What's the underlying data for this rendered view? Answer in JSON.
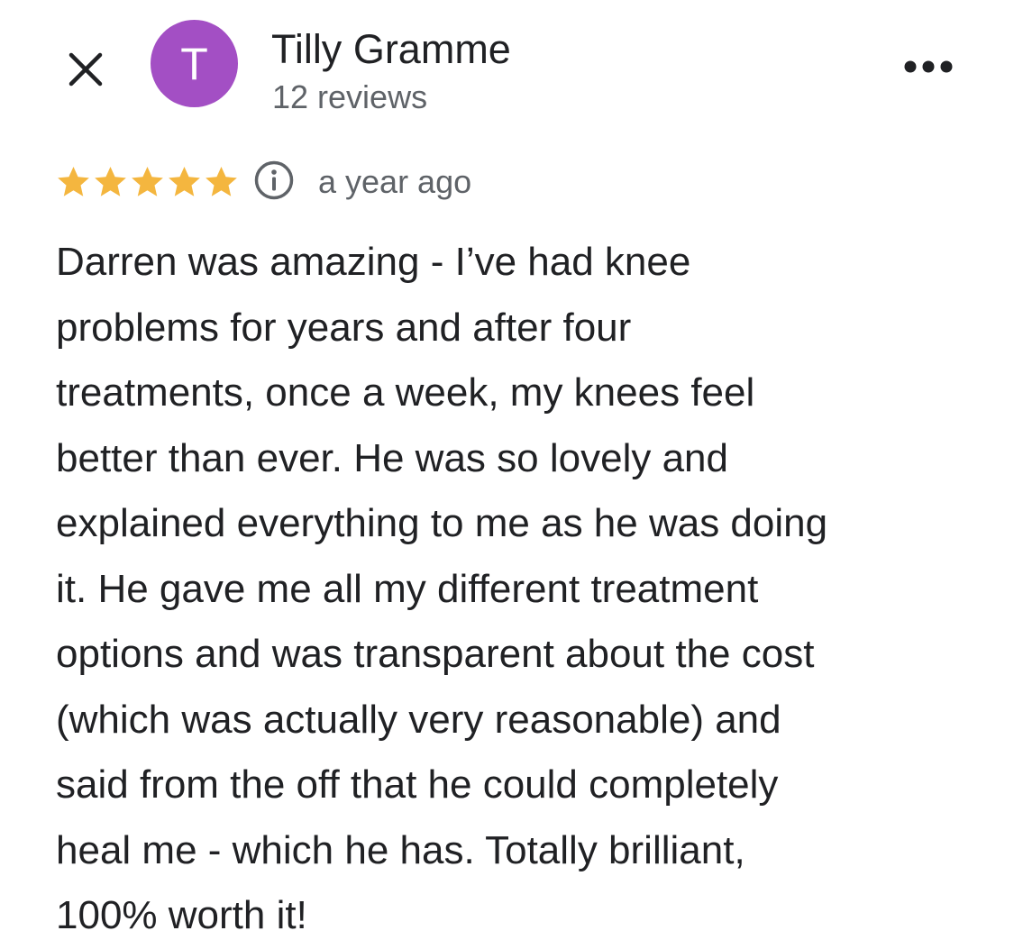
{
  "header": {
    "close_icon": "close-icon",
    "more_icon": "more-horizontal-icon"
  },
  "reviewer": {
    "avatar_letter": "T",
    "avatar_color": "#a34fc4",
    "name": "Tilly Gramme",
    "review_count": "12 reviews"
  },
  "rating": {
    "stars": 5,
    "max_stars": 5,
    "star_color": "#f4b63f",
    "info_icon": "info-icon",
    "timestamp": "a year ago"
  },
  "review": {
    "lines": [
      "Darren was amazing - I’ve had knee",
      "problems for years and after four",
      "treatments, once a week, my knees feel",
      "better than ever. He was so lovely and",
      "explained everything to me as he was doing",
      "it. He gave me all my different treatment",
      "options and was transparent about the cost",
      "(which was actually very reasonable) and",
      "said from the off that he could completely",
      "heal me - which he has. Totally brilliant,",
      "100% worth it!"
    ]
  }
}
